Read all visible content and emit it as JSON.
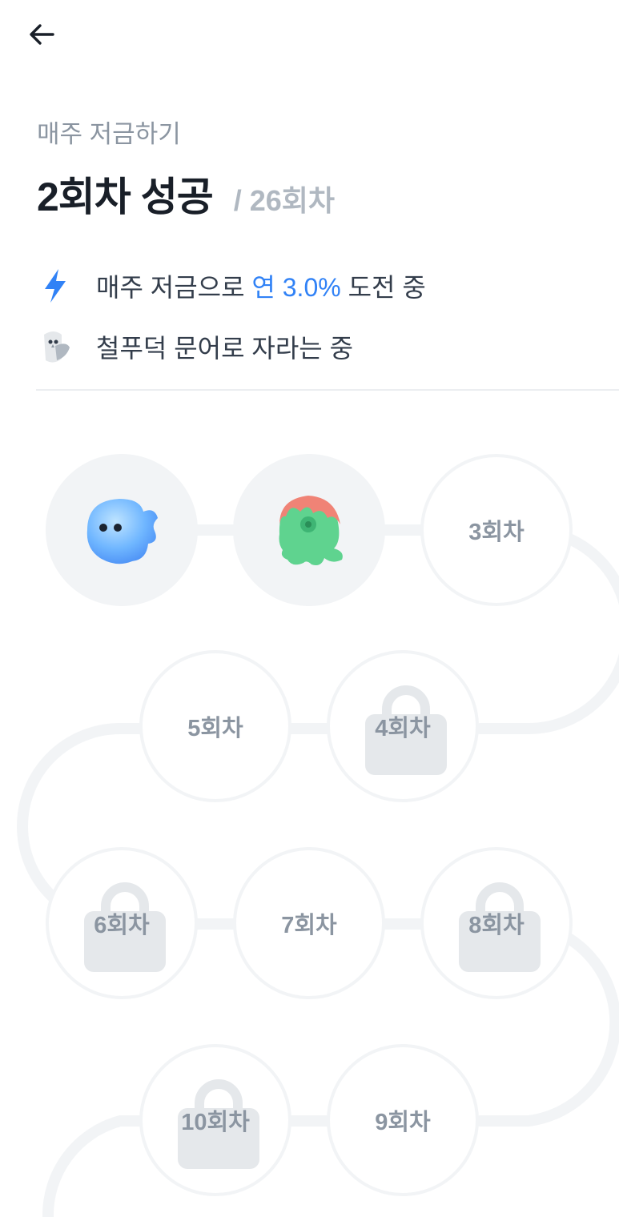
{
  "header": {
    "back_icon": "arrow-left-icon"
  },
  "page": {
    "subtitle": "매주 저금하기",
    "title": "2회차 성공",
    "total": "/ 26회차"
  },
  "info": {
    "challenge": {
      "icon": "lightning-icon",
      "prefix": "매주 저금으로 ",
      "highlight": "연 3.0%",
      "suffix": " 도전 중",
      "accent_color": "#3182f6"
    },
    "growth": {
      "icon": "owl-icon",
      "text": "철푸덕 문어로 자라는 중"
    }
  },
  "stages": [
    {
      "index": 1,
      "status": "completed",
      "icon": "blue-blob-character-icon"
    },
    {
      "index": 2,
      "status": "completed",
      "icon": "green-octopus-character-icon"
    },
    {
      "index": 3,
      "label": "3회차",
      "status": "open"
    },
    {
      "index": 4,
      "label": "4회차",
      "status": "locked"
    },
    {
      "index": 5,
      "label": "5회차",
      "status": "open"
    },
    {
      "index": 6,
      "label": "6회차",
      "status": "locked"
    },
    {
      "index": 7,
      "label": "7회차",
      "status": "open"
    },
    {
      "index": 8,
      "label": "8회차",
      "status": "locked"
    },
    {
      "index": 9,
      "label": "9회차",
      "status": "open"
    },
    {
      "index": 10,
      "label": "10회차",
      "status": "locked"
    }
  ]
}
